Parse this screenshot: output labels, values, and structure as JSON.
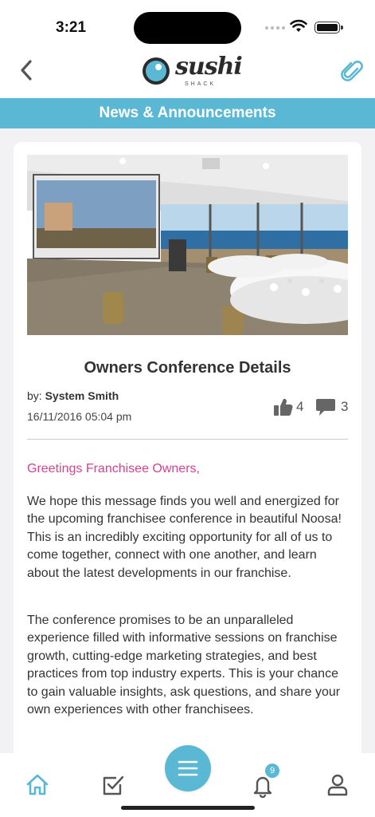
{
  "status_bar": {
    "time": "3:21"
  },
  "header": {
    "logo_word": "sushi",
    "logo_sub": "SHACK",
    "section_title": "News & Announcements"
  },
  "article": {
    "title": "Owners Conference Details",
    "by_label": "by: ",
    "author": "System Smith",
    "date": "16/11/2016 05:04 pm",
    "likes": "4",
    "comments": "3",
    "greeting": "Greetings Franchisee Owners,",
    "paragraphs": [
      "We hope this message finds you well and energized for the upcoming franchisee conference in beautiful Noosa! This is an incredibly exciting opportunity for all of us to come together, connect with one another, and learn about the latest developments in our franchise.",
      "The conference promises to be an unparalleled experience filled with informative sessions on franchise growth, cutting-edge marketing strategies, and best practices from top industry experts. This is your chance to gain valuable insights, ask questions, and share your own experiences with other franchisees."
    ]
  },
  "bottom_nav": {
    "notification_count": "9",
    "items": [
      "home-icon",
      "tasks-icon",
      "menu-icon",
      "bell-icon",
      "profile-icon"
    ]
  },
  "colors": {
    "accent": "#5bb8d4",
    "greeting": "#d6408f",
    "logo_pink": "#e0458f"
  }
}
